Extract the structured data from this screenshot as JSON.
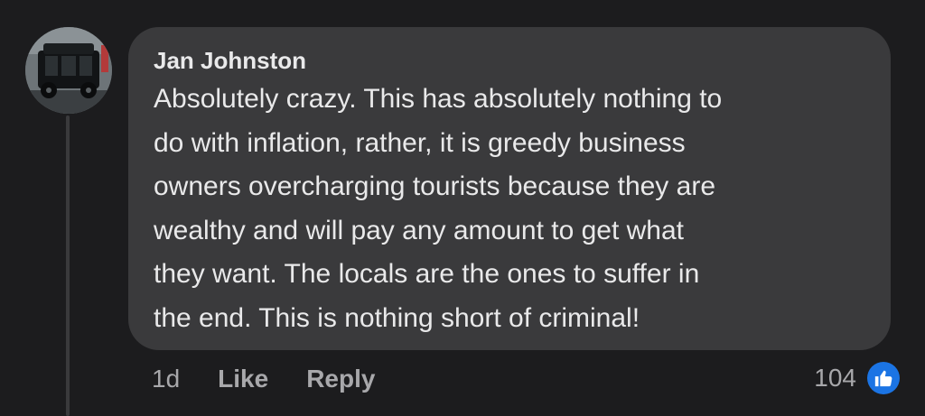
{
  "comment": {
    "author": "Jan Johnston",
    "text": "Absolutely crazy.  This has absolutely nothing to\ndo with inflation,  rather, it is greedy business\nowners overcharging tourists because they are\nwealthy and will pay any amount to get what\nthey want.   The locals are the ones to suffer in\nthe end.  This is nothing short of criminal!",
    "avatar_icon": "hearse-photo-avatar",
    "timestamp": "1d",
    "actions": {
      "like_label": "Like",
      "reply_label": "Reply"
    },
    "reactions": {
      "count": "104",
      "icon": "thumbs-up-icon",
      "color": "#1b74e4"
    }
  },
  "theme": {
    "background": "#1c1c1e",
    "bubble": "#3a3a3c",
    "text": "#e9e9ea",
    "muted": "#a8a8ab"
  }
}
